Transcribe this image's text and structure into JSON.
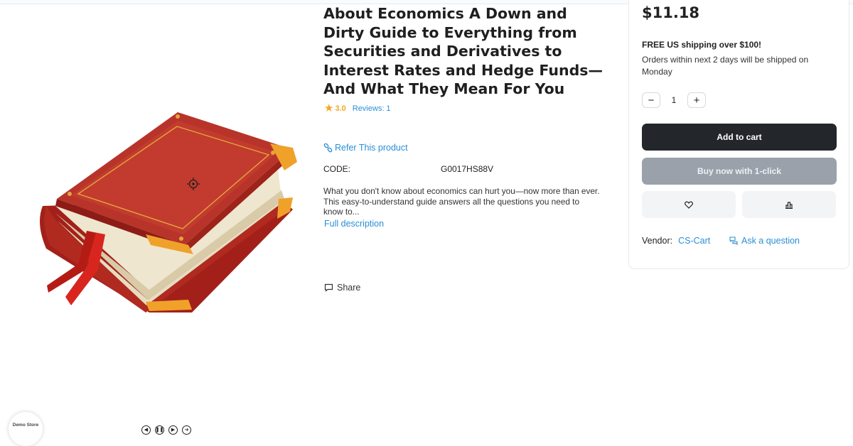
{
  "product": {
    "title": "About Economics A Down and Dirty Guide to Everything from Securities and Derivatives to Interest Rates and Hedge Funds—And What They Mean For You",
    "rating": "3.0",
    "reviews_label": "Reviews:",
    "reviews_count": "1",
    "refer_label": "Refer This product",
    "code_label": "CODE:",
    "code_value": "G0017HS88V",
    "description": "What you don't know about economics can hurt you—now more than ever. This easy-to-understand guide answers all the questions you need to know to...",
    "full_description_link": "Full description",
    "share_label": "Share",
    "image_icon": "book-image",
    "zoom_icon": "zoom-icon"
  },
  "buybox": {
    "price": "$11.18",
    "shipping_title": "FREE US shipping over $100!",
    "shipping_note": "Orders within next 2 days will be shipped on Monday",
    "qty_minus": "−",
    "qty_value": "1",
    "qty_plus": "+",
    "add_to_cart": "Add to cart",
    "buy_now": "Buy now with 1-click",
    "wishlist_icon": "heart-icon",
    "compare_icon": "compare-icon",
    "vendor_label": "Vendor:",
    "vendor_name": "CS-Cart",
    "ask_question": "Ask a question"
  },
  "footer": {
    "logo_text": "Demo Store",
    "controls": [
      "prev-icon",
      "pause-icon",
      "play-icon",
      "next-icon"
    ]
  },
  "colors": {
    "accent": "#2a8fd6",
    "star": "#f5a623",
    "primary_button": "#23262b",
    "secondary_button": "#9aa1ab"
  }
}
